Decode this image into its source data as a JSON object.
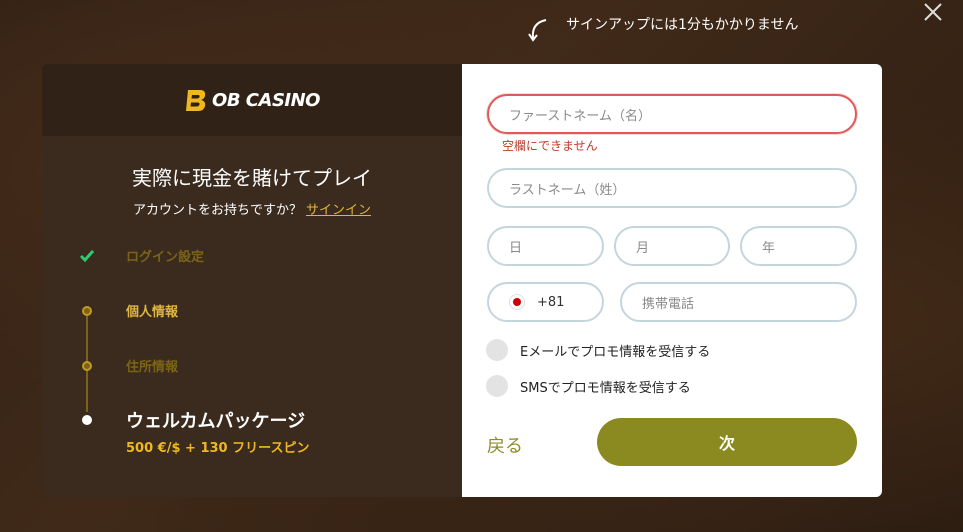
{
  "top_note": "サインアップには1分もかかりません",
  "brand": {
    "logo_text": "OB CASINO",
    "logo_letter": "B"
  },
  "left": {
    "headline": "実際に現金を賭けてプレイ",
    "account_question": "アカウントをお持ちですか？",
    "signin_link": "サインイン",
    "steps": [
      {
        "label": "ログイン設定",
        "state": "done",
        "color": "#7b6418"
      },
      {
        "label": "個人情報",
        "state": "current",
        "color": "#e0b640"
      },
      {
        "label": "住所情報",
        "state": "pending",
        "color": "#7b6418"
      },
      {
        "label": "ウェルカムパッケージ",
        "state": "info",
        "color": "#ffffff"
      }
    ],
    "welcome_sub": "500 €/$ + 130 フリースピン"
  },
  "form": {
    "first_name_placeholder": "ファーストネーム（名）",
    "first_name_error": "空欄にできません",
    "last_name_placeholder": "ラストネーム（姓）",
    "day_placeholder": "日",
    "month_placeholder": "月",
    "year_placeholder": "年",
    "phone_code": "+81",
    "phone_placeholder": "携帯電話",
    "email_promo_label": "Eメールでプロモ情報を受信する",
    "sms_promo_label": "SMSでプロモ情報を受信する",
    "back_label": "戻る",
    "next_label": "次"
  },
  "colors": {
    "accent": "#8a8a20",
    "error": "#c0392b",
    "gold": "#e0b640",
    "check_green": "#2ecc71"
  }
}
